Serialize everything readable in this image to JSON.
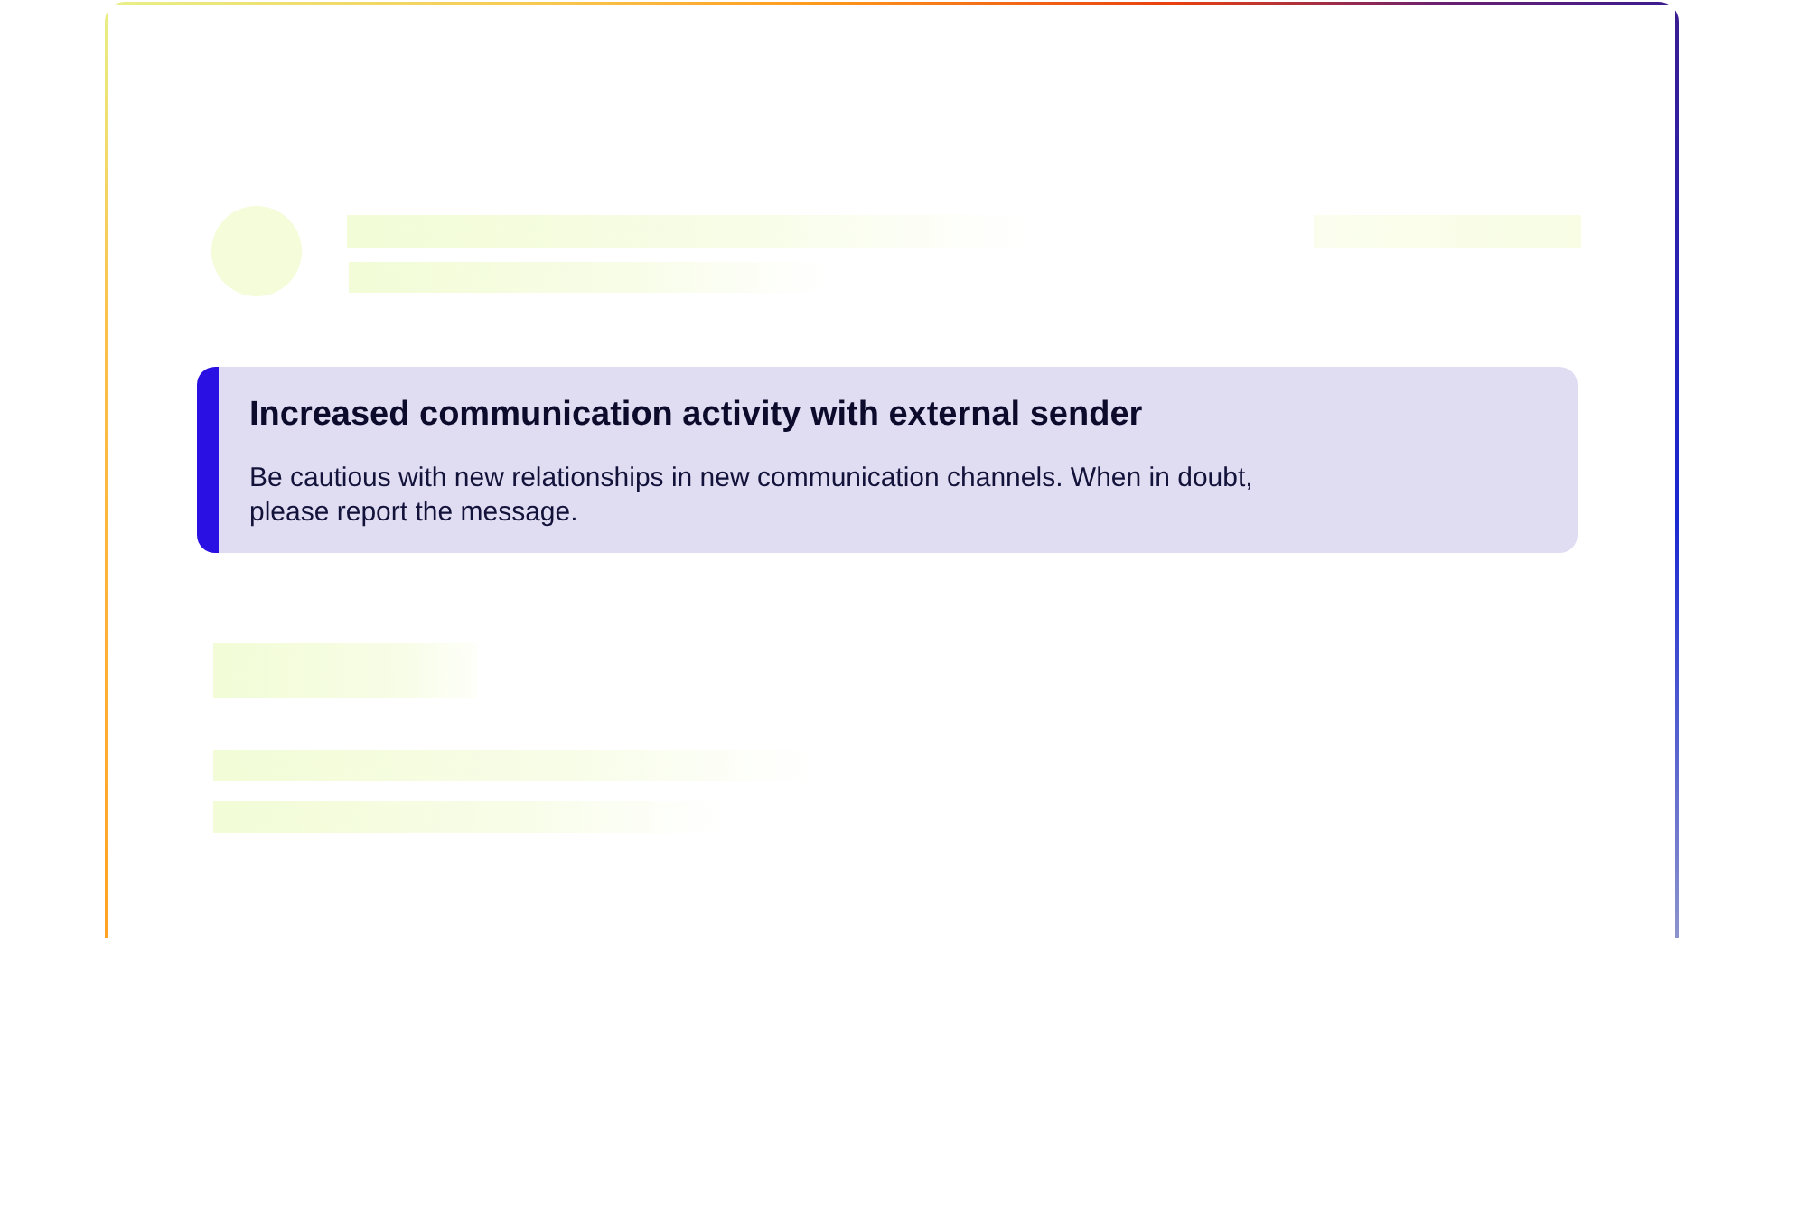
{
  "alert": {
    "title": "Increased communication activity with external sender",
    "message": "Be cautious with new relationships in new communication channels. When in doubt, please report the message."
  }
}
